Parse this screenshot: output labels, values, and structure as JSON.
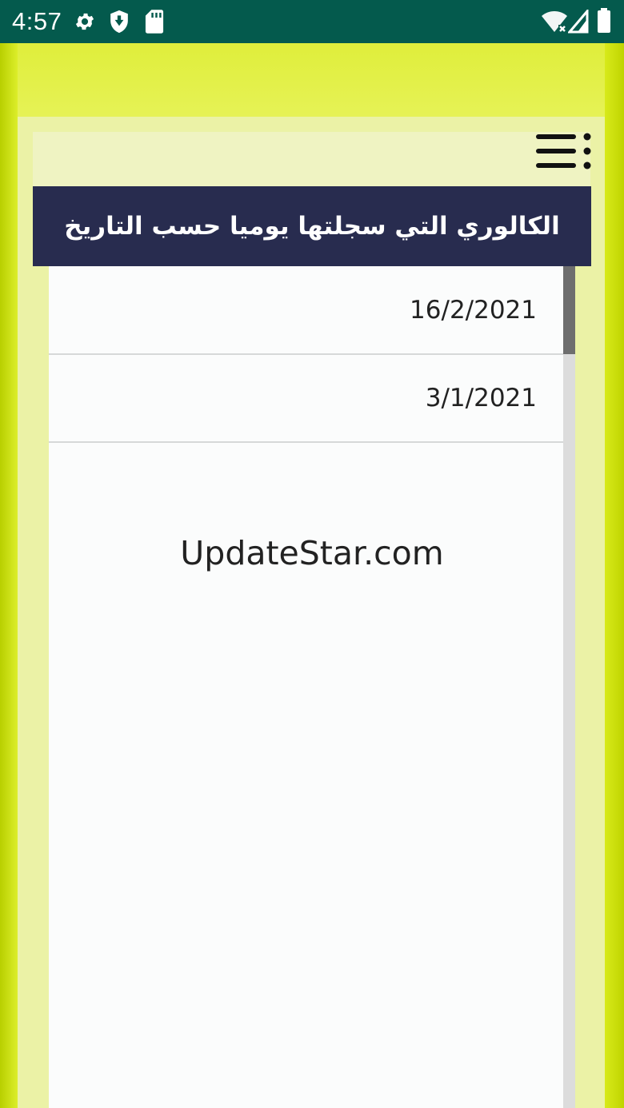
{
  "status_bar": {
    "time": "4:57",
    "left_icons": [
      "gear-icon",
      "shield-icon",
      "sd-card-icon"
    ],
    "right_icons": [
      "wifi-icon",
      "signal-icon",
      "battery-icon"
    ]
  },
  "toolbar": {
    "menu_icon": "menu-dots-icon"
  },
  "header": {
    "title": "الكالوري التي سجلتها يوميا حسب التاريخ"
  },
  "list": {
    "items": [
      {
        "label": "16/2/2021"
      },
      {
        "label": "3/1/2021"
      }
    ]
  },
  "watermark": "UpdateStar.com",
  "colors": {
    "status_bar": "#045a4d",
    "header": "#282c4f",
    "background_accent": "#d8ea1a"
  }
}
